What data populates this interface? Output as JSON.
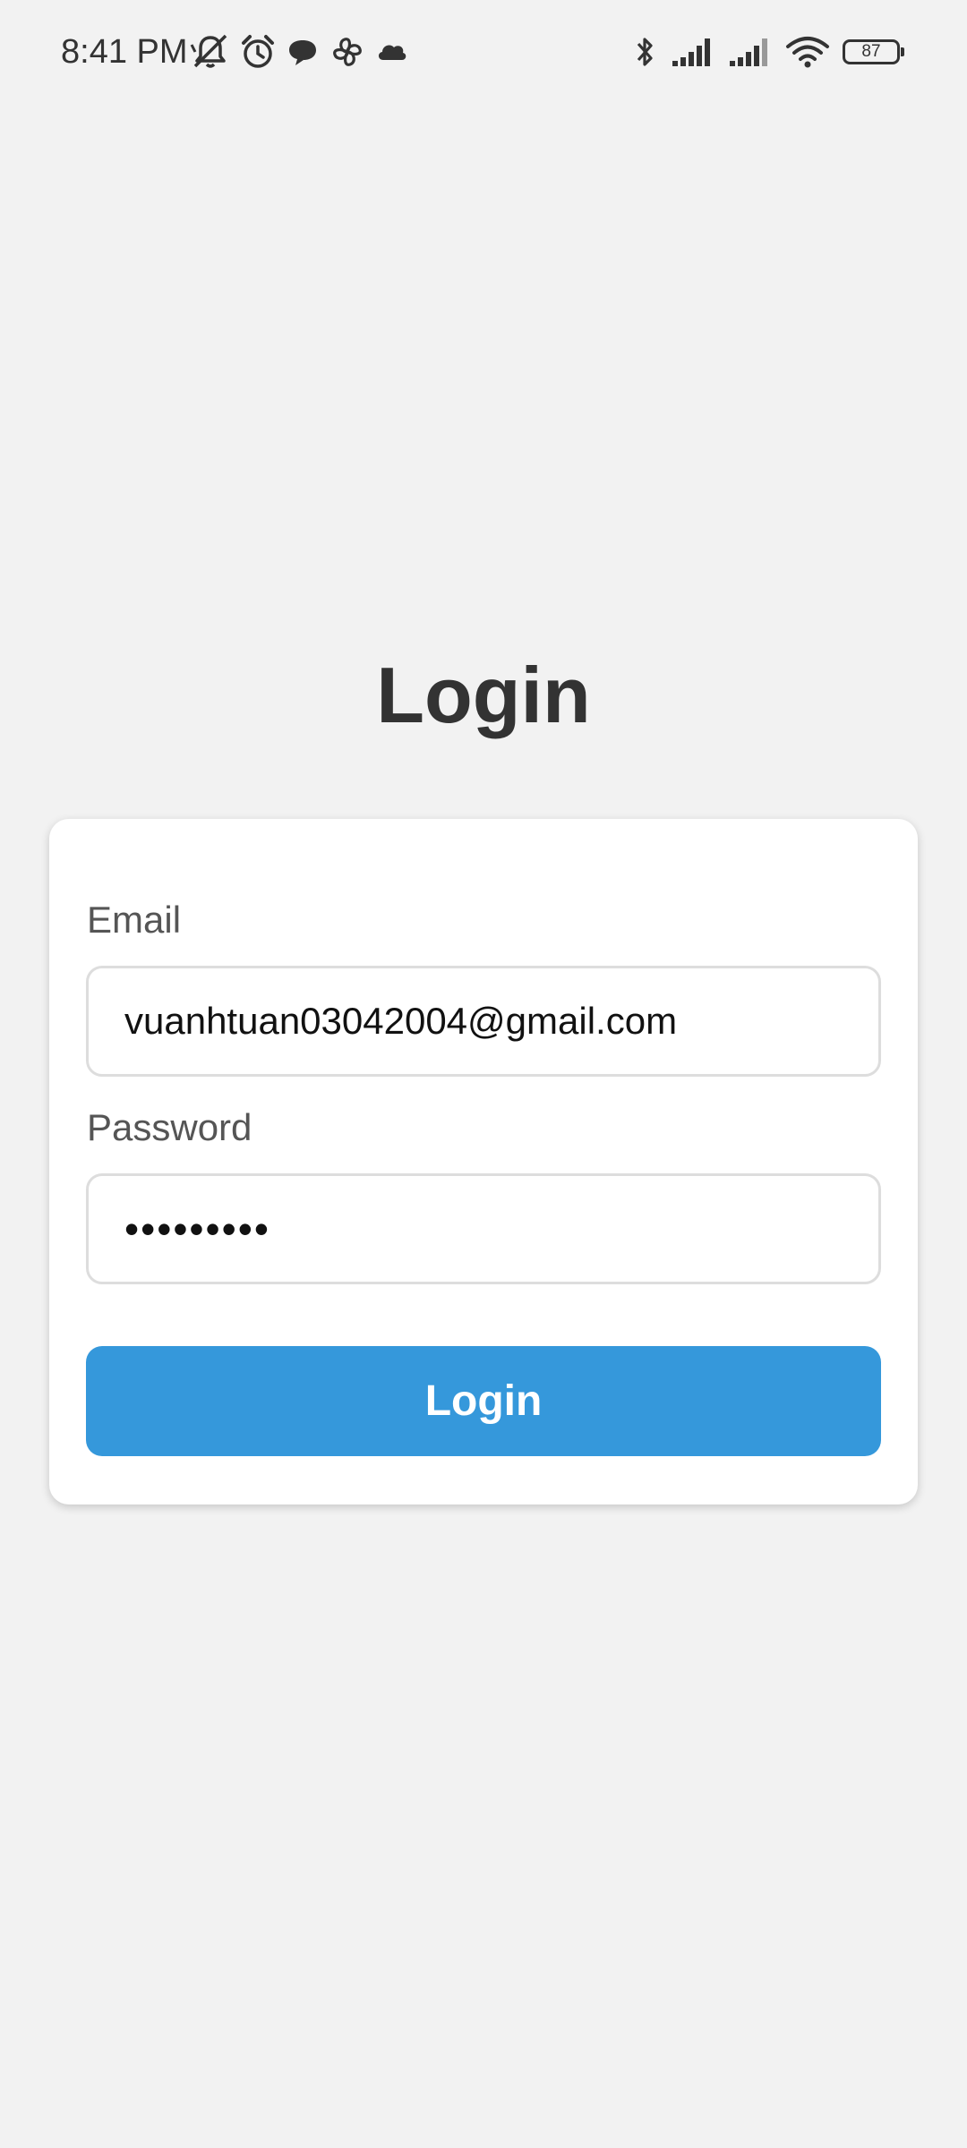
{
  "status_bar": {
    "time": "8:41 PM",
    "battery_level": "87",
    "left_icons": [
      "muted-notification-icon",
      "alarm-icon",
      "chat-bubble-icon",
      "pinwheel-icon",
      "cloud-icon"
    ],
    "right_icons": [
      "bluetooth-icon",
      "signal-icon",
      "signal-icon",
      "wifi-icon",
      "battery-icon"
    ]
  },
  "page": {
    "title": "Login"
  },
  "form": {
    "email_label": "Email",
    "email_value": "vuanhtuan03042004@gmail.com",
    "password_label": "Password",
    "password_value": "•••••••••",
    "submit_label": "Login"
  },
  "colors": {
    "background": "#f2f2f2",
    "card": "#ffffff",
    "primary_button": "#3598db",
    "title_text": "#333333",
    "label_text": "#555555"
  }
}
